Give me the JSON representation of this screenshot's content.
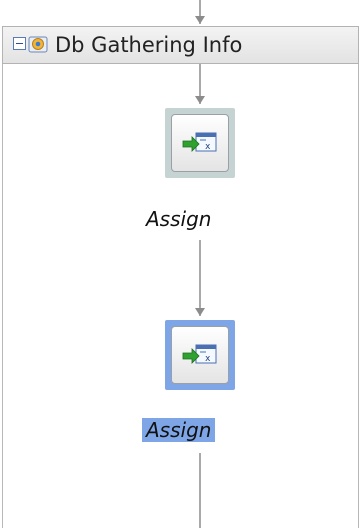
{
  "scope": {
    "title": "Db Gathering Info",
    "collapsed": false
  },
  "activities": [
    {
      "label": "Assign",
      "selected": false,
      "icon": "assign-icon"
    },
    {
      "label": "Assign",
      "selected": true,
      "icon": "assign-icon"
    }
  ],
  "colors": {
    "selection": "#7ea6e6",
    "node_frame": "#c5d3d3",
    "connector": "#8c8c8c",
    "assign_arrow": "#2fa12f"
  }
}
